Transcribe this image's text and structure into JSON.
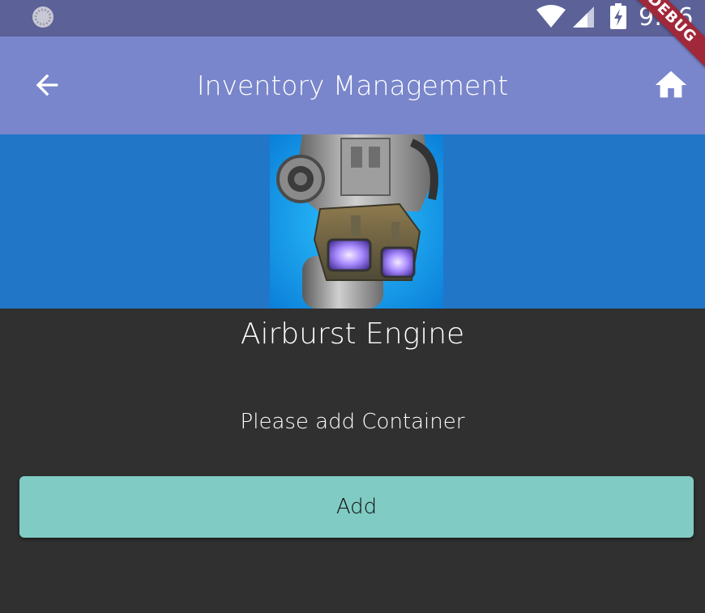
{
  "status_bar": {
    "time": "9:46",
    "icons": [
      "app-notification-icon",
      "wifi-icon",
      "signal-icon",
      "battery-icon"
    ]
  },
  "debug_banner": "DEBUG",
  "app_bar": {
    "title": "Inventory Management",
    "left_icon": "arrow-back-icon",
    "right_icon": "home-icon"
  },
  "product": {
    "name": "Airburst Engine",
    "image_icon": "engine-thruster-image"
  },
  "containers": {
    "empty_message": "Please add Container",
    "add_label": "Add"
  },
  "colors": {
    "status_bar": "#5c6198",
    "app_bar": "#7986cb",
    "image_background": "#2176c8",
    "body_background": "#303030",
    "add_button": "#80cbc4",
    "debug_banner": "#a0283a"
  }
}
